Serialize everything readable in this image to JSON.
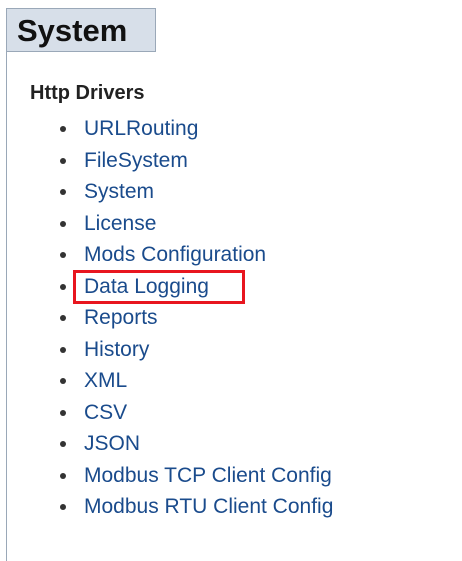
{
  "header": {
    "title": "System"
  },
  "section": {
    "title": "Http Drivers"
  },
  "drivers": [
    {
      "label": "URLRouting"
    },
    {
      "label": "FileSystem"
    },
    {
      "label": "System"
    },
    {
      "label": "License"
    },
    {
      "label": "Mods Configuration"
    },
    {
      "label": "Data Logging"
    },
    {
      "label": "Reports"
    },
    {
      "label": "History"
    },
    {
      "label": "XML"
    },
    {
      "label": "CSV"
    },
    {
      "label": "JSON"
    },
    {
      "label": "Modbus TCP Client Config"
    },
    {
      "label": "Modbus RTU Client Config"
    }
  ],
  "highlight": {
    "target": "Data Logging",
    "color": "#e8161f"
  },
  "colors": {
    "link": "#1a4b8c",
    "header_bg": "#d7dfe9"
  }
}
